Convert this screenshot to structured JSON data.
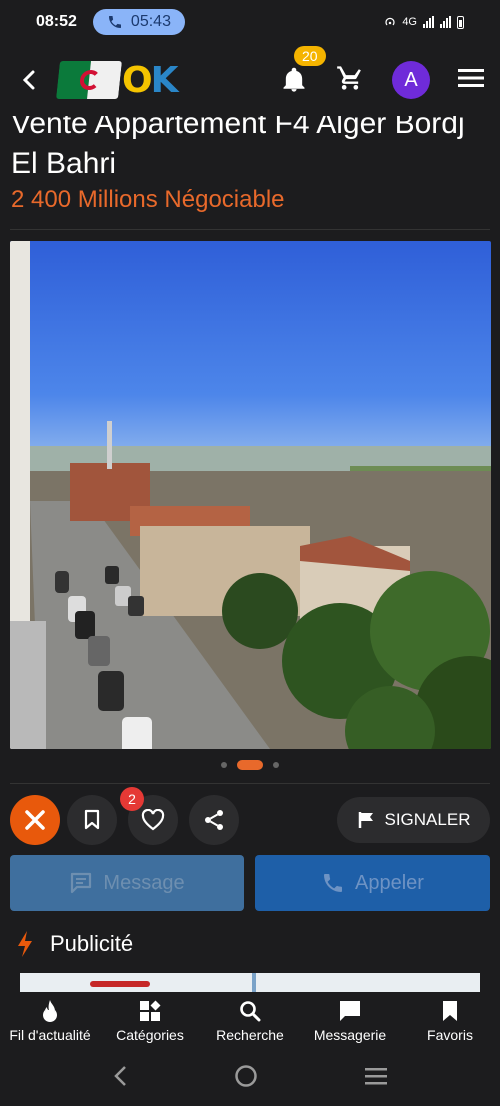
{
  "status_bar": {
    "time": "08:52",
    "call_timer": "05:43",
    "network": "4G"
  },
  "header": {
    "notification_count": "20",
    "avatar_letter": "A",
    "brand_colors": {
      "o": "#f5c400",
      "k": "#2a86c8"
    }
  },
  "listing": {
    "title": "Vente Appartement F4 Alger Bordj El Bahri",
    "price": "2 400 Millions Négociable",
    "photo_count": 3,
    "active_photo": 2
  },
  "actions": {
    "favorites_count": "2",
    "report_label": "SIGNALER",
    "message_label": "Message",
    "call_label": "Appeler"
  },
  "publicity": {
    "label": "Publicité"
  },
  "bottom_nav": {
    "items": [
      {
        "label": "Fil d'actualité",
        "icon": "fire-icon"
      },
      {
        "label": "Catégories",
        "icon": "categories-icon"
      },
      {
        "label": "Recherche",
        "icon": "search-icon"
      },
      {
        "label": "Messagerie",
        "icon": "chat-icon"
      },
      {
        "label": "Favoris",
        "icon": "bookmark-icon"
      }
    ]
  },
  "colors": {
    "accent": "#e8692b",
    "background": "#1c1c1e",
    "avatar": "#6f2bd9",
    "notification_badge": "#f5b400",
    "favorites_badge": "#e53935",
    "call_button": "#1e5fa8",
    "message_button": "#3f6f9e"
  }
}
